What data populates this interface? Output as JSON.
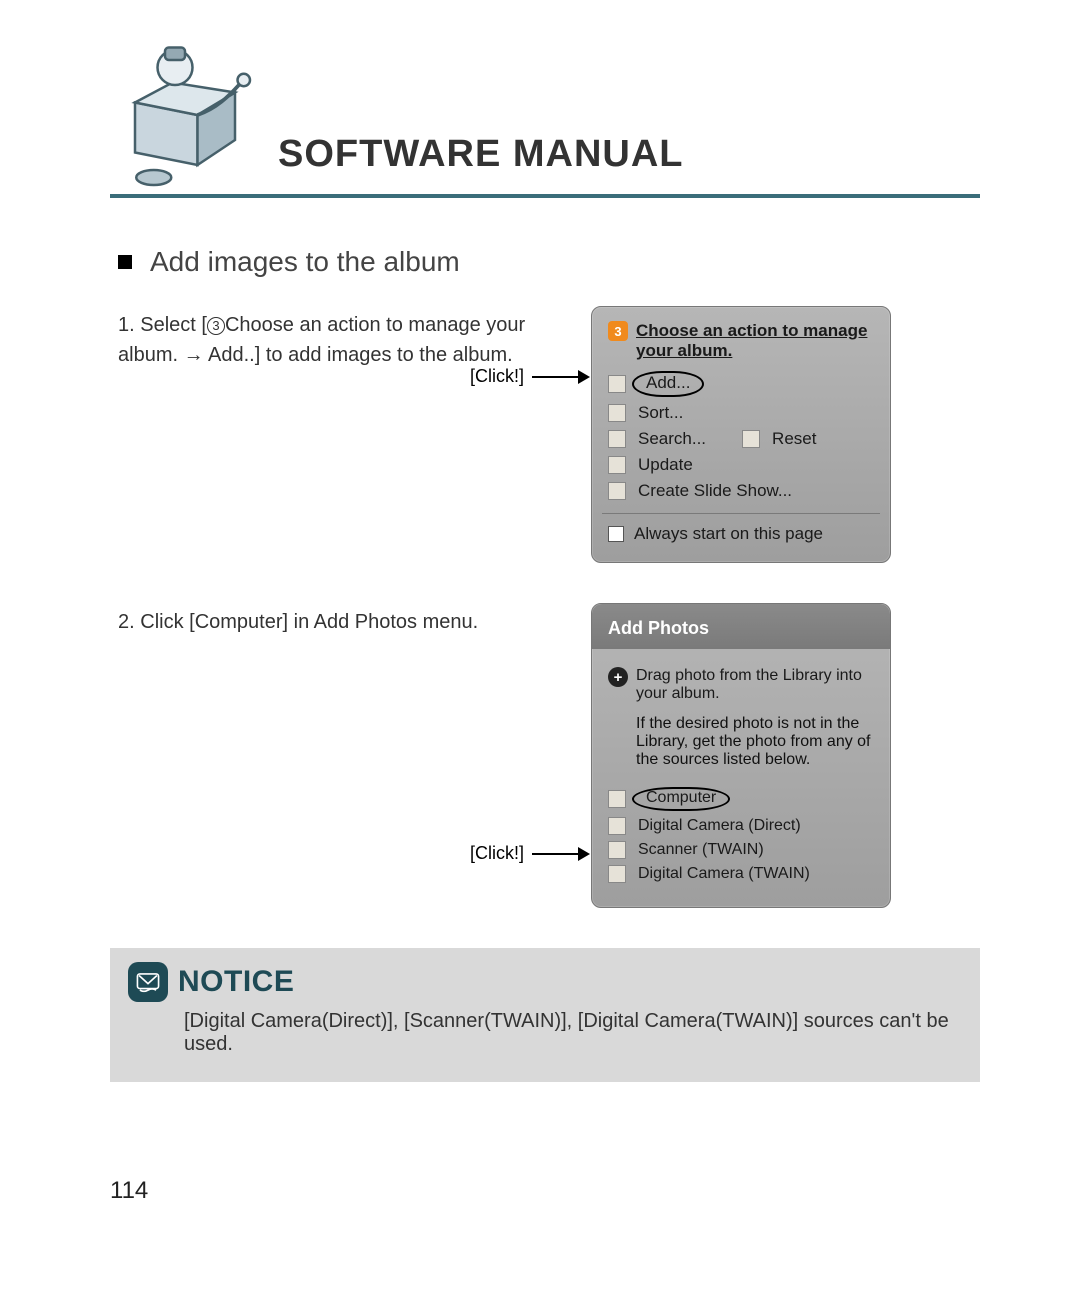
{
  "header": {
    "title": "SOFTWARE MANUAL"
  },
  "section": {
    "heading": "Add images to the album"
  },
  "steps": {
    "s1": {
      "num": "1.",
      "pre": "Select [",
      "circled": "3",
      "post": "Choose an action to manage your album. → Add..] to add images to the album."
    },
    "s2": {
      "num": "2.",
      "text": "Click [Computer] in Add Photos menu."
    }
  },
  "callouts": {
    "click1": "[Click!]",
    "click2": "[Click!]"
  },
  "panel1": {
    "badge": "3",
    "head": "Choose an action to manage your album.",
    "items": {
      "add": "Add...",
      "sort": "Sort...",
      "search": "Search...",
      "reset": "Reset",
      "update": "Update",
      "slideshow": "Create Slide Show..."
    },
    "checkbox": "Always start on this page"
  },
  "panel2": {
    "title": "Add Photos",
    "drag": "Drag photo from the Library into your album.",
    "desc": "If the desired photo is not in the Library, get the photo from any of the sources listed below.",
    "sources": {
      "computer": "Computer",
      "dc_direct": "Digital Camera (Direct)",
      "scanner": "Scanner (TWAIN)",
      "dc_twain": "Digital Camera (TWAIN)"
    }
  },
  "notice": {
    "label": "NOTICE",
    "body": "[Digital Camera(Direct)], [Scanner(TWAIN)], [Digital Camera(TWAIN)] sources can't be used."
  },
  "page_number": "114"
}
